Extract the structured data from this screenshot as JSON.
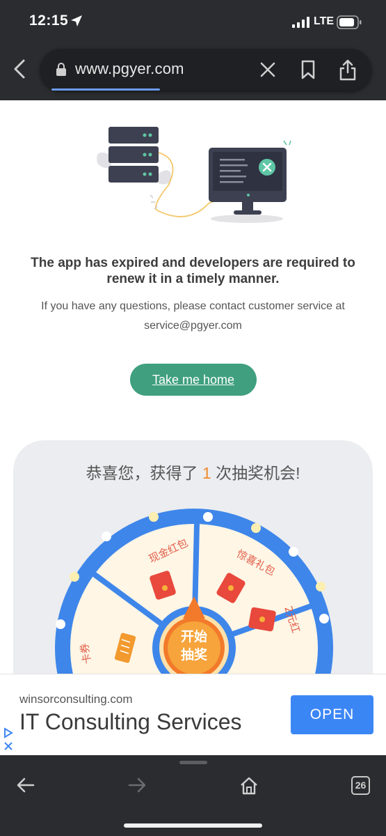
{
  "status_bar": {
    "time": "12:15",
    "network": "LTE"
  },
  "browser": {
    "url": "www.pgyer.com"
  },
  "page": {
    "headline": "The app has expired and developers are required to renew it in a timely manner.",
    "subtext": "If you have any questions, please contact customer service at service@pgyer.com",
    "home_button": "Take me home",
    "lottery": {
      "title_before": "恭喜您，获得了 ",
      "count": "1",
      "title_after": " 次抽奖机会!",
      "prizes": [
        "现金红包",
        "惊喜礼包",
        "2元红",
        "卡券"
      ],
      "center_line1": "开始",
      "center_line2": "抽奖"
    }
  },
  "ad": {
    "domain": "winsorconsulting.com",
    "title": "IT Consulting Services",
    "button": "OPEN"
  },
  "toolbar": {
    "tab_count": "26"
  },
  "colors": {
    "accent_green": "#3f9f7f",
    "ad_blue": "#3b86f5",
    "wheel_blue": "#3e86ea",
    "highlight_orange": "#f08a2c"
  }
}
